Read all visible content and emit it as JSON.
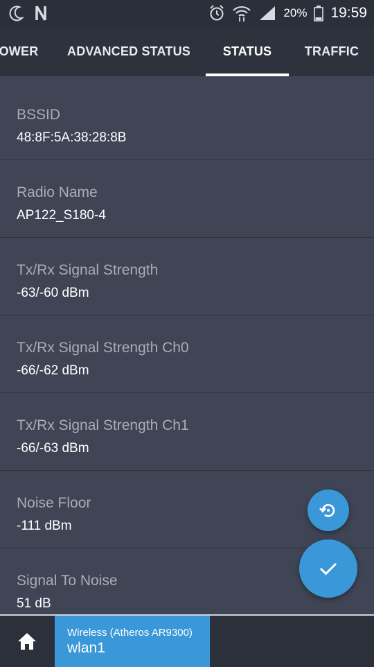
{
  "status_bar": {
    "icons": [
      "moon-icon",
      "n-notification-icon",
      "alarm-icon",
      "wifi-icon",
      "cell-signal-icon",
      "battery-icon"
    ],
    "battery_percent": "20%",
    "time": "19:59"
  },
  "tabs": [
    {
      "label": "OWER",
      "active": false
    },
    {
      "label": "ADVANCED STATUS",
      "active": false
    },
    {
      "label": "STATUS",
      "active": true
    },
    {
      "label": "TRAFFIC",
      "active": false
    }
  ],
  "rows": [
    {
      "label": "BSSID",
      "value": "48:8F:5A:38:28:8B"
    },
    {
      "label": "Radio Name",
      "value": "AP122_S180-4"
    },
    {
      "label": "Tx/Rx Signal Strength",
      "value": "-63/-60 dBm"
    },
    {
      "label": "Tx/Rx Signal Strength Ch0",
      "value": "-66/-62 dBm"
    },
    {
      "label": "Tx/Rx Signal Strength Ch1",
      "value": "-66/-63 dBm"
    },
    {
      "label": "Noise Floor",
      "value": "-111 dBm"
    },
    {
      "label": "Signal To Noise",
      "value": "51 dB"
    }
  ],
  "fabs": {
    "reset_icon": "restore-icon",
    "apply_icon": "check-icon"
  },
  "bottom_bar": {
    "home_icon": "home-icon",
    "interface_sub": "Wireless (Atheros AR9300)",
    "interface_name": "wlan1"
  },
  "colors": {
    "accent": "#3a97d8",
    "background": "#3f4555",
    "tab_bar": "#2e323d"
  }
}
